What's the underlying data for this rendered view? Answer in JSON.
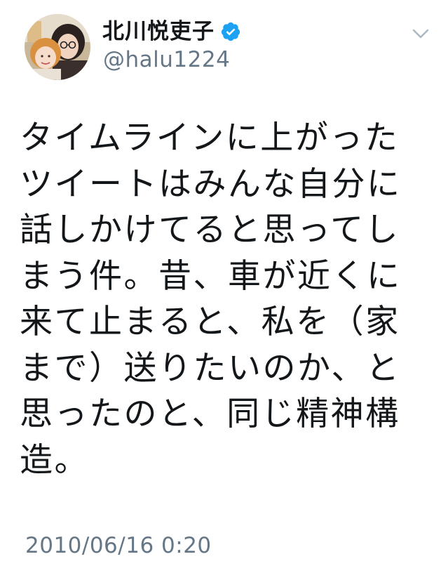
{
  "user": {
    "display_name": "北川悦吏子",
    "handle": "@halu1224",
    "verified": true,
    "avatar_icon": "profile-photo"
  },
  "tweet": {
    "text_lines": [
      "タイムラインに上がった",
      "ツイートはみんな自分に",
      "話しかけてると思ってし",
      "まう件。昔、車が近くに",
      "来て止まると、私を（家",
      "まで）送りたいのか、と",
      "思ったのと、同じ精神構",
      "造。"
    ],
    "timestamp": "2010/06/16 0:20"
  },
  "colors": {
    "text": "#14171a",
    "secondary_text": "#657786",
    "verified_badge": "#1da1f2",
    "chevron": "#aab8c2"
  }
}
